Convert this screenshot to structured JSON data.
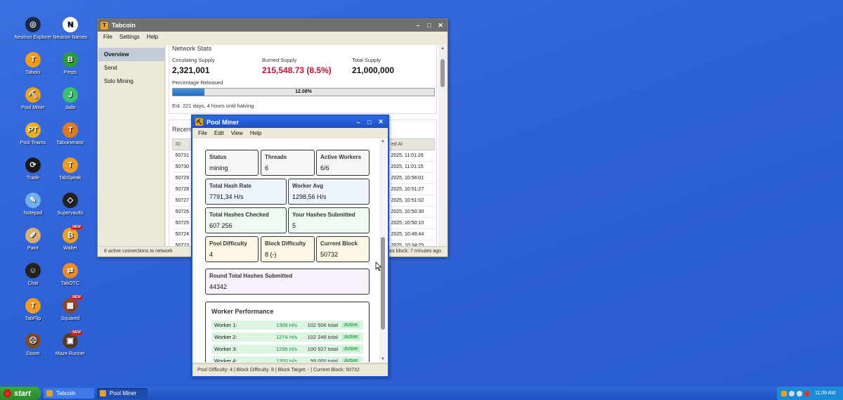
{
  "desktop": {
    "icons": [
      {
        "label": "Neutron Explorer",
        "color": "#1a2a44",
        "glyph": "◎"
      },
      {
        "label": "Neutron Names",
        "color": "#ffffff",
        "glyph": "N"
      },
      {
        "label": "Taboin",
        "color": "#f09b1a",
        "glyph": "T"
      },
      {
        "label": "Perps",
        "color": "#2a9d3a",
        "glyph": "B"
      },
      {
        "label": "Pool Miner",
        "color": "#e8a020",
        "glyph": "⛏"
      },
      {
        "label": "Jade",
        "color": "#3bbf6f",
        "glyph": "J"
      },
      {
        "label": "Pool Teams",
        "color": "#e8b020",
        "glyph": "PT"
      },
      {
        "label": "Taboinerator",
        "color": "#e07a1a",
        "glyph": "T"
      },
      {
        "label": "Trade",
        "color": "#1a1a1a",
        "glyph": "⟳"
      },
      {
        "label": "TabSpeak",
        "color": "#f09b1a",
        "glyph": "T"
      },
      {
        "label": "Notepad",
        "color": "#6fb0e8",
        "glyph": "✎"
      },
      {
        "label": "Supervaults",
        "color": "#222222",
        "glyph": "◇"
      },
      {
        "label": "Paint",
        "color": "#d8b070",
        "glyph": "✐"
      },
      {
        "label": "Wallet",
        "color": "#f0a020",
        "glyph": "₿"
      },
      {
        "label": "Chat",
        "color": "#222222",
        "glyph": "☺"
      },
      {
        "label": "TabOTC",
        "color": "#f08a20",
        "glyph": "⇄"
      },
      {
        "label": "TabFlip",
        "color": "#f09b1a",
        "glyph": "T"
      },
      {
        "label": "Squared",
        "color": "#8a4a2a",
        "glyph": "▦"
      },
      {
        "label": "Doom",
        "color": "#7a4a2a",
        "glyph": "☹"
      },
      {
        "label": "Maze Runner",
        "color": "#5a3a2a",
        "glyph": "▣"
      }
    ],
    "new_badge": "NEW"
  },
  "tabcoin": {
    "title": "Tabcoin",
    "menu": [
      "File",
      "Settings",
      "Help"
    ],
    "nav": [
      "Overview",
      "Send",
      "Solo Mining"
    ],
    "network_stats": {
      "heading": "Network Stats",
      "circulating_label": "Circulating Supply",
      "circulating_value": "2,321,001",
      "burned_label": "Burned Supply",
      "burned_value": "215,548.73 (8.5%)",
      "total_label": "Total Supply",
      "total_value": "21,000,000",
      "released_label": "Percentage Released",
      "released_pct": 12.08,
      "released_text": "12.08%",
      "halving_text": "Est. 221 days, 4 hours until halving"
    },
    "recent_heading": "Recent",
    "blocks_header": {
      "id": "ID",
      "mined_at": "ed At"
    },
    "blocks": [
      {
        "id": "50731",
        "at": "2025, 11:01:26"
      },
      {
        "id": "50730",
        "at": "2025, 11:01:15"
      },
      {
        "id": "50729",
        "at": "2025, 10:56:01"
      },
      {
        "id": "50728",
        "at": "2025, 10:51:27"
      },
      {
        "id": "50727",
        "at": "2025, 10:51:02"
      },
      {
        "id": "50726",
        "at": "2025, 10:50:30"
      },
      {
        "id": "50725",
        "at": "2025, 10:50:10"
      },
      {
        "id": "50724",
        "at": "2025, 10:49:44"
      },
      {
        "id": "50723",
        "at": "2025, 10:34:25"
      }
    ],
    "status_left": "8 active connections to network",
    "status_right": "ast block: 7 minutes ago"
  },
  "pool": {
    "title": "Pool Miner",
    "menu": [
      "File",
      "Edit",
      "View",
      "Help"
    ],
    "stats": {
      "status_k": "Status",
      "status_v": "mining",
      "threads_k": "Threads",
      "threads_v": "6",
      "workers_k": "Active Workers",
      "workers_v": "6/6",
      "hash_k": "Total Hash Rate",
      "hash_v": "7791,34 H/s",
      "avg_k": "Worker Avg",
      "avg_v": "1298,56 H/s",
      "checked_k": "Total Hashes Checked",
      "checked_v": "607 256",
      "submitted_k": "Your Hashes Submitted",
      "submitted_v": "5",
      "pooldiff_k": "Pool Difficulty",
      "pooldiff_v": "4",
      "blockdiff_k": "Block Difficulty",
      "blockdiff_v": "8 (-)",
      "curblock_k": "Current Block",
      "curblock_v": "50732",
      "round_k": "Round Total Hashes Submitted",
      "round_v": "44342"
    },
    "perf_title": "Worker Performance",
    "workers": [
      {
        "name": "Worker 1:",
        "rate": "1308 H/s",
        "total": "102 506 total",
        "state": "Active"
      },
      {
        "name": "Worker 2:",
        "rate": "1274 H/s",
        "total": "102 246 total",
        "state": "Active"
      },
      {
        "name": "Worker 3:",
        "rate": "1296 H/s",
        "total": "100 927 total",
        "state": "Active"
      },
      {
        "name": "Worker 4:",
        "rate": "1300 H/s",
        "total": "99 000 total",
        "state": "Active"
      }
    ],
    "status": "Pool Difficulty: 4 | Block Difficulty: 8 | Block Target: - | Current Block: 50732"
  },
  "taskbar": {
    "start": "start",
    "tasks": [
      "Tabcoin",
      "Pool Miner"
    ],
    "clock": "11:09 AM"
  }
}
